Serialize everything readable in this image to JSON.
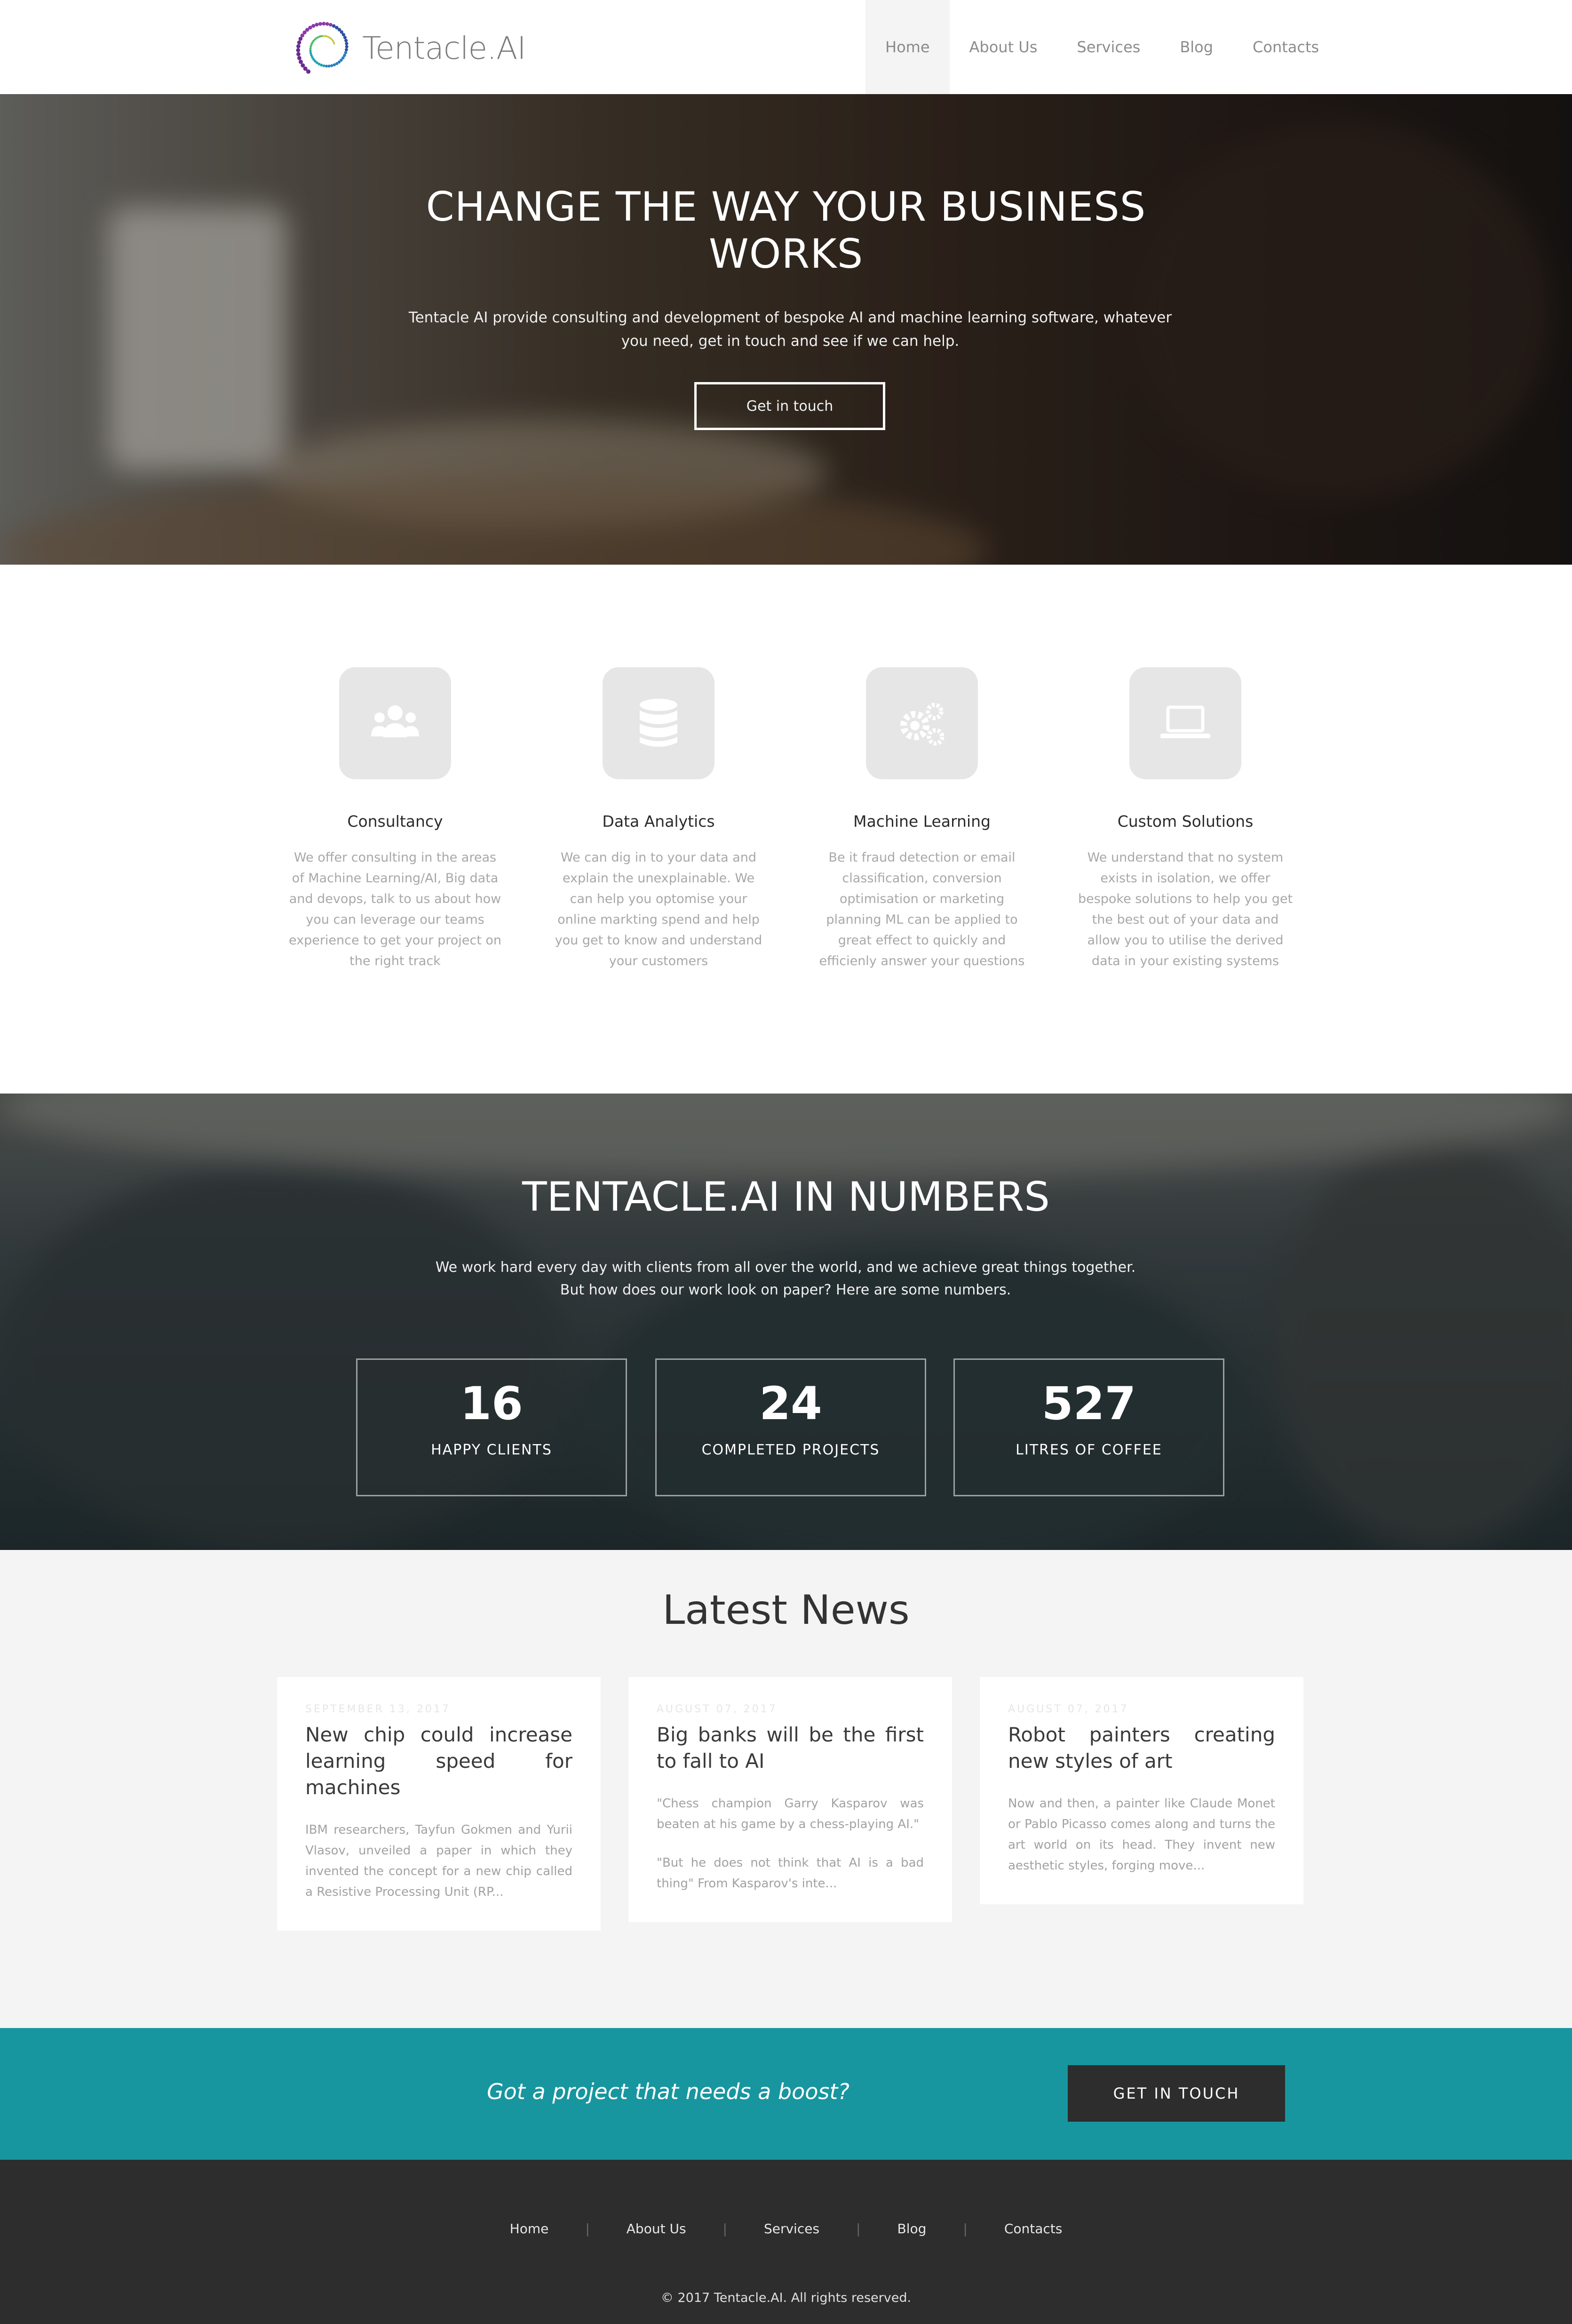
{
  "brand": {
    "name": "Tentacle.AI"
  },
  "nav": {
    "items": [
      {
        "label": "Home",
        "active": true
      },
      {
        "label": "About Us"
      },
      {
        "label": "Services"
      },
      {
        "label": "Blog"
      },
      {
        "label": "Contacts"
      }
    ]
  },
  "hero": {
    "title_line1": "CHANGE THE WAY YOUR BUSINESS",
    "title_line2": "WORKS",
    "subtitle": "Tentacle AI provide consulting and development of bespoke AI and machine learning software, whatever you need, get in touch and see if we can help.",
    "button": "Get in touch"
  },
  "services": [
    {
      "icon": "users-icon",
      "title": "Consultancy",
      "text": "We offer consulting in the areas of Machine Learning/AI, Big data and devops, talk to us about how you can leverage our teams experience to get your project on the right track"
    },
    {
      "icon": "database-icon",
      "title": "Data Analytics",
      "text": "We can dig in to your data and explain the unexplainable. We can help you optomise your online markting spend and help you get to know and understand your customers"
    },
    {
      "icon": "gears-icon",
      "title": "Machine Learning",
      "text": "Be it fraud detection or email classification, conversion optimisation or marketing planning ML can be applied to great effect to quickly and efficienly answer your questions"
    },
    {
      "icon": "laptop-icon",
      "title": "Custom Solutions",
      "text": "We understand that no system exists in isolation, we offer bespoke solutions to help you get the best out of your data and allow you to utilise the derived data in your existing systems"
    }
  ],
  "numbers": {
    "title": "TENTACLE.AI IN NUMBERS",
    "sub_line1": "We work hard every day with clients from all over the world, and we achieve great things together.",
    "sub_line2": "But how does our work look on paper? Here are some numbers.",
    "stats": [
      {
        "value": "16",
        "label": "HAPPY CLIENTS"
      },
      {
        "value": "24",
        "label": "COMPLETED PROJECTS"
      },
      {
        "value": "527",
        "label": "LITRES OF COFFEE"
      }
    ]
  },
  "news": {
    "title": "Latest News",
    "posts": [
      {
        "date": "SEPTEMBER 13, 2017",
        "title": "New chip could increase learning speed for machines",
        "paragraphs": [
          "IBM researchers, Tayfun Gokmen and Yurii Vlasov, unveiled a paper in which they invented the concept for a new chip called a Resistive Processing Unit (RP..."
        ]
      },
      {
        "date": "AUGUST 07, 2017",
        "title": "Big banks will be the first to fall to AI",
        "paragraphs": [
          "\"Chess champion Garry Kasparov was beaten at his game by a chess-playing AI.\"",
          "\"But he does not think that AI is a bad thing\" From Kasparov's inte..."
        ]
      },
      {
        "date": "AUGUST 07, 2017",
        "title": "Robot painters creating new styles of art",
        "paragraphs": [
          "Now and then, a painter like Claude Monet or Pablo Picasso comes along and turns the art world on its head. They invent new aesthetic styles, forging move..."
        ]
      }
    ]
  },
  "cta": {
    "text": "Got a project that needs a boost?",
    "button": "GET IN TOUCH"
  },
  "footer": {
    "links": [
      "Home",
      "About Us",
      "Services",
      "Blog",
      "Contacts"
    ],
    "copyright": "© 2017 Tentacle.AI. All rights reserved."
  },
  "colors": {
    "accent": "#17969f",
    "dark": "#2d2d2d",
    "light_bg": "#f4f4f4"
  }
}
